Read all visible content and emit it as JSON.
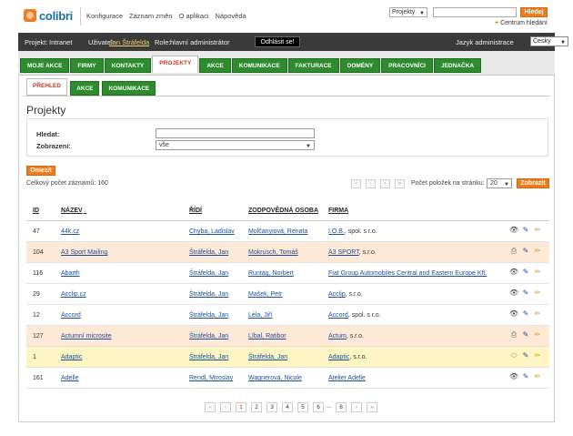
{
  "header": {
    "logo_text": "colibri",
    "nav": [
      "Konfigurace",
      "Záznam změn",
      "O aplikaci",
      "Nápověda"
    ],
    "search_scope": "Projekty",
    "search_value": "",
    "search_button": "Hledej",
    "search_center": "Centrum hledání"
  },
  "infobar": {
    "project_label": "Projekt:",
    "project_value": "Intranet",
    "user_label": "Uživatel:",
    "user_value": "Jan Štráfelda",
    "role_label": "Role:",
    "role_value": "hlavní administrátor",
    "logout": "Odhlásit se!",
    "lang_label": "Jazyk administrace",
    "lang_value": "Česky"
  },
  "maintabs": [
    "MOJE AKCE",
    "FIRMY",
    "KONTAKTY",
    "PROJEKTY",
    "AKCE",
    "KOMUNIKACE",
    "FAKTURACE",
    "DOMÉNY",
    "PRACOVNÍCI",
    "JEDNAČKA"
  ],
  "maintab_active": "PROJEKTY",
  "subtabs": [
    "PŘEHLED",
    "AKCE",
    "KOMUNIKACE"
  ],
  "subtab_active": "PŘEHLED",
  "page_title": "Projekty",
  "filter": {
    "search_label": "Hledat:",
    "search_value": "",
    "view_label": "Zobrazení:",
    "view_value": "vše",
    "limit_button": "Omezit"
  },
  "total": "Celkový počet záznamů: 160",
  "perpage": {
    "label": "Počet položek na stránku:",
    "value": "20",
    "button": "Zobrazit"
  },
  "pager_top": [
    "«",
    "‹",
    "›",
    "»"
  ],
  "table": {
    "headers": {
      "id": "ID",
      "name": "NÁZEV",
      "sort_arrow": "↓",
      "leads": "ŘÍDÍ",
      "responsible": "ZODPOVĚDNÁ OSOBA",
      "company": "FIRMA"
    },
    "rows": [
      {
        "id": "47",
        "name": "44k.cz",
        "leads": "Chyba, Ladislav",
        "responsible": "Molčanyiová, Renata",
        "company": "I.O.B.",
        "company_suffix": ", spol. s r.o.",
        "style": "white",
        "icons": [
          "eye",
          "edit",
          "pen"
        ]
      },
      {
        "id": "104",
        "name": "A3 Sport Mailing",
        "leads": "Štráfelda, Jan",
        "responsible": "Mokrusch, Tomáš",
        "company": "A3 SPORT",
        "company_suffix": ", s.r.o.",
        "style": "alt",
        "icons": [
          "print",
          "edit",
          "pen"
        ]
      },
      {
        "id": "116",
        "name": "Abarth",
        "leads": "Štráfelda, Jan",
        "responsible": "Runtag, Norbert",
        "company": "Fiat Group Automobiles Central and Eastern Europe Kft.",
        "company_suffix": "",
        "style": "white",
        "icons": [
          "eye",
          "edit",
          "pen"
        ]
      },
      {
        "id": "29",
        "name": "Acclip.cz",
        "leads": "Štráfelda, Jan",
        "responsible": "Mašek, Petr",
        "company": "Acclip",
        "company_suffix": ", s.r.o.",
        "style": "white",
        "icons": [
          "eye",
          "edit",
          "pen"
        ]
      },
      {
        "id": "12",
        "name": "Accord",
        "leads": "Štráfelda, Jan",
        "responsible": "Léla, Jiří",
        "company": "Accord",
        "company_suffix": ", spol. s r.o.",
        "style": "white",
        "icons": [
          "eye",
          "edit",
          "pen"
        ]
      },
      {
        "id": "127",
        "name": "Actumní microsite",
        "leads": "Štráfelda, Jan",
        "responsible": "Líbal, Ratibor",
        "company": "Actum",
        "company_suffix": ", s.r.o.",
        "style": "alt",
        "icons": [
          "print",
          "edit",
          "pen"
        ]
      },
      {
        "id": "1",
        "name": "Adaptic",
        "leads": "Štráfelda, Jan",
        "responsible": "Štráfelda, Jan",
        "company": "Adaptic",
        "company_suffix": ", s.r.o.",
        "style": "yel",
        "icons": [
          "oval",
          "edit",
          "pen"
        ]
      },
      {
        "id": "161",
        "name": "Adelle",
        "leads": "Rendl, Miroslav",
        "responsible": "Wagnerová, Nicole",
        "company": "Atelier Adelle",
        "company_suffix": "",
        "style": "white",
        "icons": [
          "eye",
          "edit",
          "pen"
        ]
      }
    ]
  },
  "pager_bottom": {
    "first": "«",
    "prev": "‹",
    "pages": [
      "1",
      "2",
      "3",
      "4",
      "5",
      "6"
    ],
    "dots": "...",
    "last_page": "8",
    "next": "›",
    "last": "»",
    "current": "1"
  },
  "colors": {
    "accent": "#f07c1e",
    "tab_green": "#2e8b2e",
    "link": "#1a4f9c",
    "row_alt": "#fde9d5",
    "row_highlight": "#fdf6c3"
  }
}
